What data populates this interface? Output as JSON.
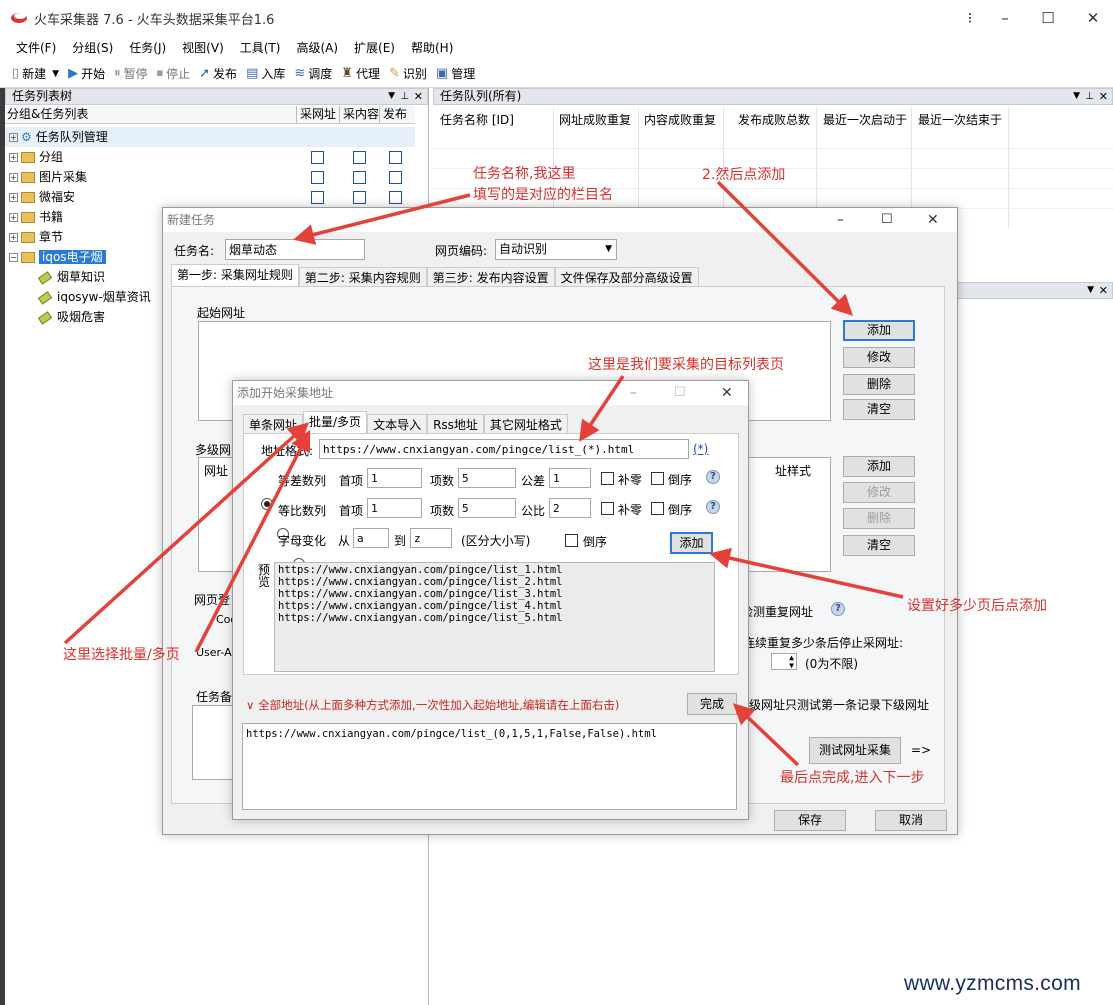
{
  "app": {
    "title": "火车采集器 7.6 - 火车头数据采集平台1.6"
  },
  "menu": [
    "文件(F)",
    "分组(S)",
    "任务(J)",
    "视图(V)",
    "工具(T)",
    "高级(A)",
    "扩展(E)",
    "帮助(H)"
  ],
  "toolbar": [
    "新建",
    "开始",
    "暂停",
    "停止",
    "发布",
    "入库",
    "调度",
    "代理",
    "识别",
    "管理"
  ],
  "left_pane": {
    "title": "任务列表树",
    "col_headers": [
      "分组&任务列表",
      "采网址",
      "采内容",
      "发布"
    ],
    "rows": [
      {
        "label": "任务队列管理"
      },
      {
        "label": "分组"
      },
      {
        "label": "图片采集"
      },
      {
        "label": "微福安"
      },
      {
        "label": "书籍"
      },
      {
        "label": "章节"
      },
      {
        "label": "iqos电子烟"
      },
      {
        "label": "烟草知识"
      },
      {
        "label": "iqosyw-烟草资讯"
      },
      {
        "label": "吸烟危害"
      }
    ]
  },
  "right_pane": {
    "title": "任务队列(所有)",
    "col_headers": [
      "任务名称 [ID]",
      "网址成败重复",
      "内容成败重复",
      "发布成败总数",
      "最近一次启动于",
      "最近一次结束于"
    ]
  },
  "new_task": {
    "title": "新建任务",
    "task_name_label": "任务名:",
    "task_name_value": "烟草动态",
    "encoding_label": "网页编码:",
    "encoding_value": "自动识别",
    "tabs": [
      "第一步: 采集网址规则",
      "第二步: 采集内容规则",
      "第三步: 发布内容设置",
      "文件保存及部分高级设置"
    ],
    "start_url_label": "起始网址",
    "buttons_top": [
      "添加",
      "修改",
      "删除",
      "清空"
    ],
    "multilevel_label": "多级网",
    "url_label_partial": "网址",
    "style_label": "址样式",
    "buttons_mid": [
      "添加",
      "修改",
      "删除",
      "清空"
    ],
    "web_login_label": "网页登",
    "cookie_label": "Coo",
    "ua_label": "User-Ag",
    "dedupe_label": "检测重复网址",
    "stop_label": "连续重复多少条后停止采网址:",
    "unlimited_label": "(0为不限)",
    "task_note_label": "任务备",
    "test_only_label": "级网址只测试第一条记录下级网址",
    "test_button": "测试网址采集",
    "test_arrow": "=>",
    "save_button": "保存",
    "cancel_button": "取消"
  },
  "add_url": {
    "title": "添加开始采集地址",
    "tabs": [
      "单条网址",
      "批量/多页",
      "文本导入",
      "Rss地址",
      "其它网址格式"
    ],
    "format_label": "地址格式:",
    "format_value": "https://www.cnxiangyan.com/pingce/list_(*).html",
    "format_link": "(*)",
    "arith": {
      "label": "等差数列",
      "first_label": "首项",
      "first": "1",
      "count_label": "项数",
      "count": "5",
      "diff_label": "公差",
      "diff": "1",
      "pad_label": "补零",
      "rev_label": "倒序"
    },
    "geo": {
      "label": "等比数列",
      "first_label": "首项",
      "first": "1",
      "count_label": "项数",
      "count": "5",
      "ratio_label": "公比",
      "ratio": "2",
      "pad_label": "补零",
      "rev_label": "倒序"
    },
    "letters": {
      "label": "字母变化",
      "from_label": "从",
      "from": "a",
      "to_label": "到",
      "to": "z",
      "case_label": "(区分大小写)",
      "rev_label": "倒序"
    },
    "add_button": "添加",
    "preview_label": "预览",
    "preview": [
      "https://www.cnxiangyan.com/pingce/list_1.html",
      "https://www.cnxiangyan.com/pingce/list_2.html",
      "https://www.cnxiangyan.com/pingce/list_3.html",
      "https://www.cnxiangyan.com/pingce/list_4.html",
      "https://www.cnxiangyan.com/pingce/list_5.html"
    ],
    "all_label": "∨ 全部地址(从上面多种方式添加,一次性加入起始地址,编辑请在上面右击)",
    "done_button": "完成",
    "all_value": "https://www.cnxiangyan.com/pingce/list_(0,1,5,1,False,False).html"
  },
  "annotations": [
    "任务名称,我这里\n填写的是对应的栏目名",
    "2.然后点添加",
    "这里是我们要采集的目标列表页",
    "设置好多少页后点添加",
    "这里选择批量/多页",
    "最后点完成,进入下一步"
  ],
  "watermark": "www.yzmcms.com",
  "colors": {
    "annotation": "#d9302c",
    "selected_row": "#cce4f7",
    "accent": "#2a7bd4"
  }
}
